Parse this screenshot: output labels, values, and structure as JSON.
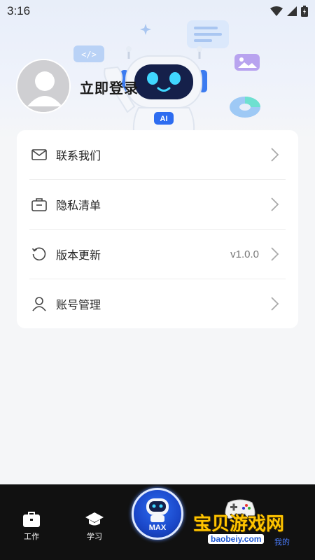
{
  "status_bar": {
    "time": "3:16"
  },
  "profile": {
    "login_label": "立即登录",
    "robot_badge": "AI"
  },
  "menu": [
    {
      "label": "联系我们",
      "value": "",
      "icon": "mail-icon"
    },
    {
      "label": "隐私清单",
      "value": "",
      "icon": "briefcase-icon"
    },
    {
      "label": "版本更新",
      "value": "v1.0.0",
      "icon": "refresh-icon"
    },
    {
      "label": "账号管理",
      "value": "",
      "icon": "user-icon"
    }
  ],
  "tabbar": {
    "items": [
      {
        "label": "工作",
        "icon": "briefcase-icon"
      },
      {
        "label": "学习",
        "icon": "graduation-cap-icon"
      },
      {
        "label": "MAX",
        "icon": "robot-icon"
      },
      {
        "label": "我的",
        "icon": "user-icon"
      }
    ]
  },
  "watermark": {
    "text": "宝贝游戏网",
    "url": "baobeiy.com"
  },
  "colors": {
    "accent": "#2d6cf0",
    "tabbar_bg": "#111111",
    "watermark": "#ffc400"
  }
}
